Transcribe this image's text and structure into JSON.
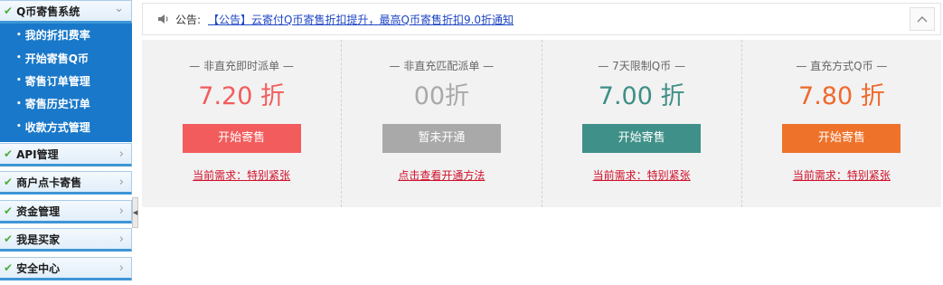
{
  "sidebar": {
    "sections": [
      {
        "label": "Q币寄售系统",
        "arrow": "chevron-down",
        "expanded": true
      },
      {
        "label": "API管理",
        "arrow": "chevron-right"
      },
      {
        "label": "商户点卡寄售",
        "arrow": "chevron-right"
      },
      {
        "label": "资金管理",
        "arrow": "chevron-right"
      },
      {
        "label": "我是买家",
        "arrow": "chevron-right"
      },
      {
        "label": "安全中心",
        "arrow": "chevron-right"
      }
    ],
    "sub_items": [
      {
        "label": "我的折扣费率"
      },
      {
        "label": "开始寄售Q币"
      },
      {
        "label": "寄售订单管理"
      },
      {
        "label": "寄售历史订单"
      },
      {
        "label": "收款方式管理"
      }
    ],
    "check_glyph": "✔",
    "bullet_glyph": "•",
    "chevron_right_glyph": "›",
    "chevron_down_glyph": "⌄",
    "collapse_glyph": "◀"
  },
  "notice": {
    "label": "公告:",
    "link_text": "【公告】云寄付Q币寄售折扣提升，最高Q币寄售折扣9.0折通知",
    "icon": "speaker-icon",
    "up_icon": "chevron-up-icon"
  },
  "cards": [
    {
      "title": "— 非直充即时派单 —",
      "rate": "7.20 折",
      "rate_color": "#f25c5c",
      "button": "开始寄售",
      "button_color": "#f25c5c",
      "link": "当前需求：特别紧张"
    },
    {
      "title": "— 非直充匹配派单 —",
      "rate": "00折",
      "rate_color": "#a9a9a9",
      "button": "暂未开通",
      "button_color": "#a9a9a9",
      "link": "点击查看开通方法"
    },
    {
      "title": "— 7天限制Q币 —",
      "rate": "7.00 折",
      "rate_color": "#3e8f86",
      "button": "开始寄售",
      "button_color": "#3f9088",
      "link": "当前需求：特别紧张"
    },
    {
      "title": "— 直充方式Q币 —",
      "rate": "7.80 折",
      "rate_color": "#ee6a2c",
      "button": "开始寄售",
      "button_color": "#ef722b",
      "link": "当前需求：特别紧张"
    }
  ]
}
